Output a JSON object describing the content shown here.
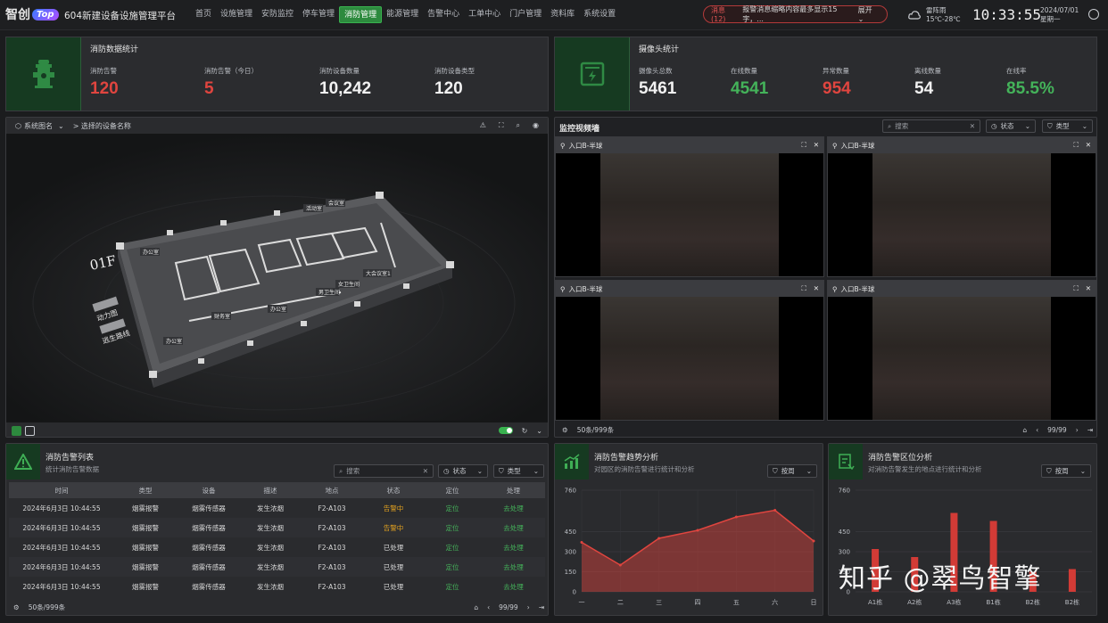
{
  "app": {
    "logo_text": "智创",
    "logo_badge": "Top",
    "title": "604新建设备设施管理平台"
  },
  "nav": [
    "首页",
    "设施管理",
    "安防监控",
    "停车管理",
    "消防管理",
    "能源管理",
    "告警中心",
    "工单中心",
    "门户管理",
    "资料库",
    "系统设置"
  ],
  "nav_active": "消防管理",
  "alert": {
    "count_label": "消息(12)",
    "text": "报警消息缩略内容最多显示15字，...",
    "expand": "展开"
  },
  "weather": {
    "cond": "雷阵雨",
    "temp": "15℃-28℃"
  },
  "clock": "10:33:55",
  "date": {
    "day": "2024/07/01",
    "weekday": "星期一"
  },
  "fire_stats": {
    "title": "消防数据统计",
    "items": [
      {
        "label": "消防告警",
        "value": "120",
        "color": "red"
      },
      {
        "label": "消防告警（今日）",
        "value": "5",
        "color": "red"
      },
      {
        "label": "消防设备数量",
        "value": "10,242",
        "color": "white"
      },
      {
        "label": "消防设备类型",
        "value": "120",
        "color": "white"
      }
    ]
  },
  "camera_stats": {
    "title": "摄像头统计",
    "items": [
      {
        "label": "摄像头总数",
        "value": "5461",
        "color": "white"
      },
      {
        "label": "在线数量",
        "value": "4541",
        "color": "green"
      },
      {
        "label": "异常数量",
        "value": "954",
        "color": "red"
      },
      {
        "label": "离线数量",
        "value": "54",
        "color": "white"
      },
      {
        "label": "在线率",
        "value": "85.5%",
        "color": "green"
      }
    ]
  },
  "map": {
    "system_select": "系统图名",
    "device_crumb": "> 选择的设备名称",
    "floor": "01F",
    "buttons": [
      "动力图",
      "逃生路线"
    ],
    "rooms": [
      "办公室",
      "会议室",
      "活动室",
      "办公室",
      "财务室",
      "办公室",
      "男卫生间",
      "女卫生间",
      "大会议室1",
      "休闲室"
    ]
  },
  "video_wall": {
    "title": "监控视频墙",
    "search_placeholder": "搜索",
    "status_label": "状态",
    "type_label": "类型",
    "cells": [
      "入口B-半球",
      "入口B-半球",
      "入口B-半球",
      "入口B-半球"
    ],
    "pager": {
      "count": "50条/999条",
      "page": "99/99"
    }
  },
  "alarm_list": {
    "title": "消防告警列表",
    "subtitle": "统计消防告警数据",
    "search_placeholder": "搜索",
    "status_label": "状态",
    "type_label": "类型",
    "columns": [
      "时间",
      "类型",
      "设备",
      "描述",
      "地点",
      "状态",
      "定位",
      "处理"
    ],
    "rows": [
      [
        "2024年6月3日 10:44:55",
        "烟雾报警",
        "烟雾传感器",
        "发生浓烟",
        "F2-A103",
        "告警中",
        "定位",
        "去处理"
      ],
      [
        "2024年6月3日 10:44:55",
        "烟雾报警",
        "烟雾传感器",
        "发生浓烟",
        "F2-A103",
        "告警中",
        "定位",
        "去处理"
      ],
      [
        "2024年6月3日 10:44:55",
        "烟雾报警",
        "烟雾传感器",
        "发生浓烟",
        "F2-A103",
        "已处理",
        "定位",
        "去处理"
      ],
      [
        "2024年6月3日 10:44:55",
        "烟雾报警",
        "烟雾传感器",
        "发生浓烟",
        "F2-A103",
        "已处理",
        "定位",
        "去处理"
      ],
      [
        "2024年6月3日 10:44:55",
        "烟雾报警",
        "烟雾传感器",
        "发生浓烟",
        "F2-A103",
        "已处理",
        "定位",
        "去处理"
      ]
    ],
    "pager": {
      "count": "50条/999条",
      "page": "99/99"
    }
  },
  "trend": {
    "title": "消防告警趋势分析",
    "subtitle": "对园区的消防告警进行统计和分析",
    "period_label": "按周"
  },
  "area": {
    "title": "消防告警区位分析",
    "subtitle": "对消防告警发生的地点进行统计和分析",
    "period_label": "按周"
  },
  "chart_data": [
    {
      "type": "area",
      "categories": [
        "一",
        "二",
        "三",
        "四",
        "五",
        "六",
        "日"
      ],
      "values": [
        370,
        200,
        400,
        460,
        560,
        610,
        380
      ],
      "yticks": [
        0,
        150,
        300,
        450,
        760
      ],
      "ylim": [
        0,
        760
      ],
      "color": "#e0453f"
    },
    {
      "type": "bar",
      "categories": [
        "A1栋",
        "A2栋",
        "A3栋",
        "B1栋",
        "B2栋",
        "B2栋"
      ],
      "values": [
        320,
        260,
        590,
        530,
        150,
        170
      ],
      "yticks": [
        0,
        150,
        300,
        450,
        760
      ],
      "ylim": [
        0,
        760
      ],
      "color": "#d23b36"
    }
  ],
  "watermark": "知乎 @翠鸟智擎"
}
